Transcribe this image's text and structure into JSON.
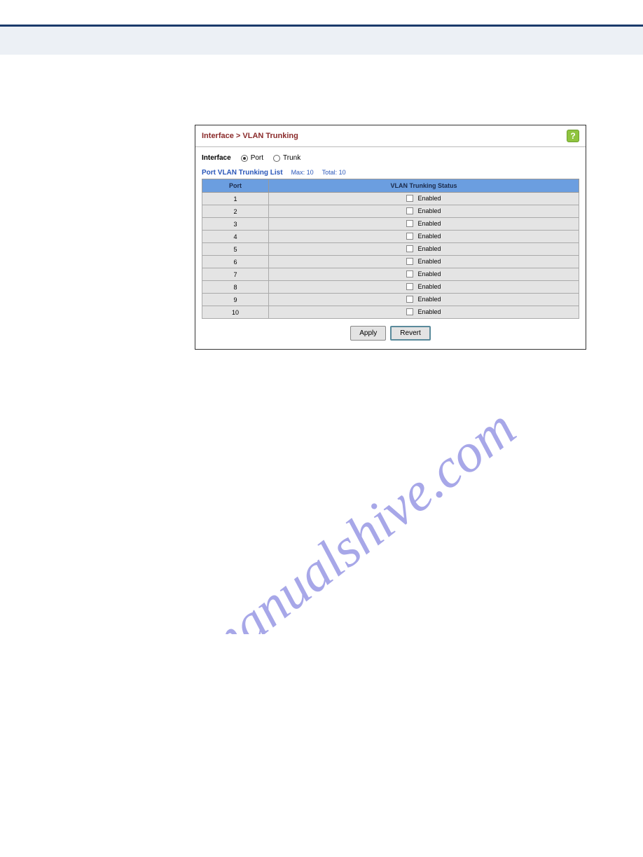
{
  "watermark_text": "manualshive.com",
  "breadcrumb": "Interface > VLAN Trunking",
  "help_label": "?",
  "interface_row": {
    "label": "Interface",
    "radio_port": "Port",
    "radio_trunk": "Trunk"
  },
  "list": {
    "title": "Port VLAN Trunking List",
    "max_label": "Max: 10",
    "total_label": "Total: 10"
  },
  "columns": {
    "port": "Port",
    "status": "VLAN Trunking Status"
  },
  "status_text": "Enabled",
  "rows": [
    {
      "port": "1"
    },
    {
      "port": "2"
    },
    {
      "port": "3"
    },
    {
      "port": "4"
    },
    {
      "port": "5"
    },
    {
      "port": "6"
    },
    {
      "port": "7"
    },
    {
      "port": "8"
    },
    {
      "port": "9"
    },
    {
      "port": "10"
    }
  ],
  "buttons": {
    "apply": "Apply",
    "revert": "Revert"
  }
}
